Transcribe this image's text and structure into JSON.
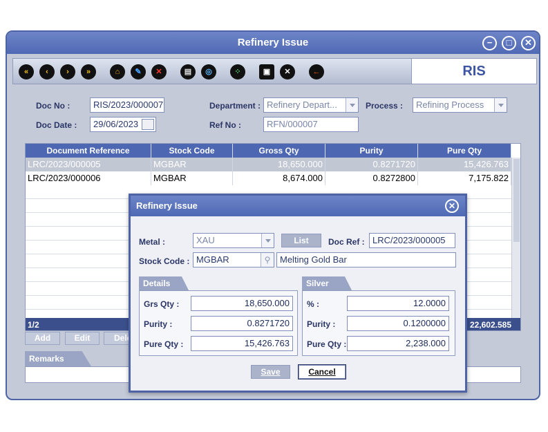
{
  "window": {
    "title": "Refinery Issue",
    "tab_code": "RIS"
  },
  "window_controls": {
    "minimize": "−",
    "maximize": "□",
    "close": "✕"
  },
  "toolbar": {
    "icons": [
      "first-icon",
      "previous-icon",
      "next-icon",
      "last-icon",
      "new-icon",
      "edit-icon",
      "delete-icon",
      "print-icon",
      "search-icon",
      "attach-icon",
      "save-icon",
      "cancel-icon",
      "exit-icon"
    ]
  },
  "header": {
    "doc_no_label": "Doc No :",
    "doc_no": "RIS/2023/000007",
    "doc_date_label": "Doc Date :",
    "doc_date": "29/06/2023",
    "department_label": "Department :",
    "department": "Refinery Depart...",
    "ref_no_label": "Ref No :",
    "ref_no": "RFN/000007",
    "process_label": "Process :",
    "process": "Refining Process"
  },
  "grid": {
    "columns": [
      "Document Reference",
      "Stock Code",
      "Gross Qty",
      "Purity",
      "Pure Qty"
    ],
    "rows": [
      [
        "LRC/2023/000005",
        "MGBAR",
        "18,650.000",
        "0.8271720",
        "15,426.763"
      ],
      [
        "LRC/2023/000006",
        "MGBAR",
        "8,674.000",
        "0.8272800",
        "7,175.822"
      ]
    ],
    "pager": "1/2",
    "total_pure_qty": "22,602.585"
  },
  "grid_buttons": {
    "add": "Add",
    "edit": "Edit",
    "delete": "Dele"
  },
  "remarks_label": "Remarks",
  "modal": {
    "title": "Refinery Issue",
    "close": "✕",
    "metal_label": "Metal :",
    "metal": "XAU",
    "list_button": "List",
    "doc_ref_label": "Doc Ref :",
    "doc_ref": "LRC/2023/000005",
    "stock_code_label": "Stock Code :",
    "stock_code": "MGBAR",
    "stock_desc": "Melting Gold Bar",
    "details": {
      "title": "Details",
      "grs_qty_label": "Grs Qty :",
      "grs_qty": "18,650.000",
      "purity_label": "Purity :",
      "purity": "0.8271720",
      "pure_qty_label": "Pure Qty :",
      "pure_qty": "15,426.763"
    },
    "silver": {
      "title": "Silver",
      "pct_label": "% :",
      "pct": "12.0000",
      "purity_label": "Purity :",
      "purity": "0.1200000",
      "pure_qty_label": "Pure Qty :",
      "pure_qty": "2,238.000"
    },
    "save_button": "Save",
    "cancel_button": "Cancel"
  }
}
